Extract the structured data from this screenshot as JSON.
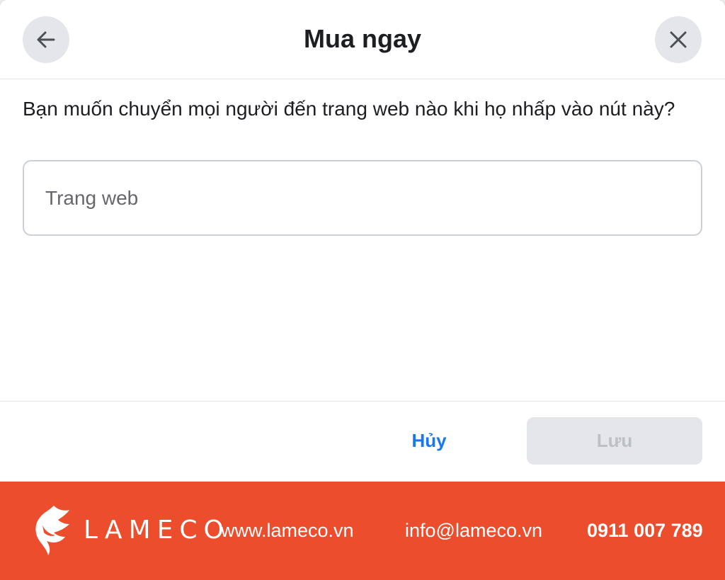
{
  "dialog": {
    "title": "Mua ngay",
    "back_icon": "arrow-left-icon",
    "close_icon": "close-icon",
    "question": "Bạn muốn chuyển mọi người đến trang web nào khi họ nhấp vào nút này?",
    "url_input": {
      "placeholder": "Trang web",
      "value": ""
    },
    "cancel_label": "Hủy",
    "save_label": "Lưu"
  },
  "brand": {
    "logo_text": "LAMECO",
    "logo_icon": "horse-head-icon",
    "website": "www.lameco.vn",
    "email": "info@lameco.vn",
    "phone": "0911 007 789"
  },
  "colors": {
    "accent_blue": "#1877f2",
    "brand_red": "#ec4d2d",
    "disabled_button": "#e4e6eb"
  }
}
